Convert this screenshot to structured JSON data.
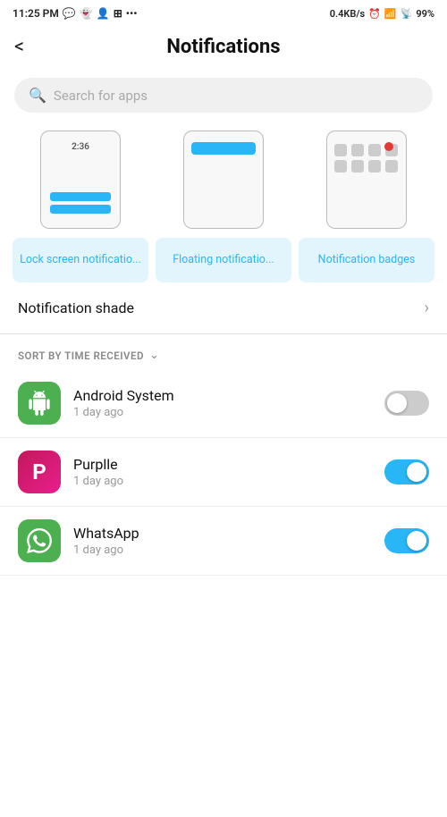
{
  "statusBar": {
    "time": "11:25 PM",
    "network": "0.4KB/s",
    "battery": "99%"
  },
  "header": {
    "backLabel": "<",
    "title": "Notifications"
  },
  "search": {
    "placeholder": "Search for apps"
  },
  "notifTypes": [
    {
      "id": "lock-screen",
      "label": "Lock screen notificatio...",
      "type": "lock"
    },
    {
      "id": "floating",
      "label": "Floating notificatio...",
      "type": "floating"
    },
    {
      "id": "badges",
      "label": "Notification badges",
      "type": "badge"
    }
  ],
  "notifShade": {
    "label": "Notification shade"
  },
  "sortBar": {
    "label": "SORT BY TIME RECEIVED"
  },
  "apps": [
    {
      "name": "Android System",
      "time": "1 day ago",
      "toggleOn": false,
      "iconType": "android"
    },
    {
      "name": "Purplle",
      "time": "1 day ago",
      "toggleOn": true,
      "iconType": "purplle"
    },
    {
      "name": "WhatsApp",
      "time": "1 day ago",
      "toggleOn": true,
      "iconType": "whatsapp"
    }
  ]
}
